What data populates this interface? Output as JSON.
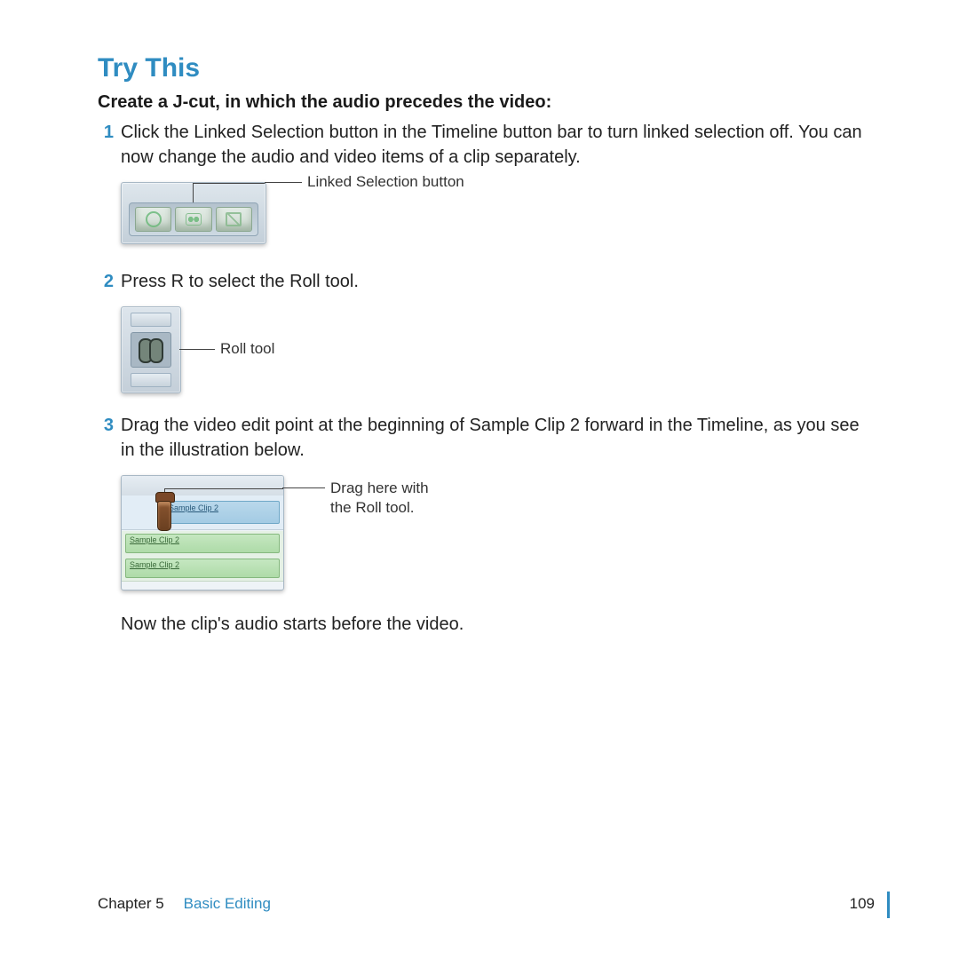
{
  "header": "Try This",
  "subheader": "Create a J-cut, in which the audio precedes the video:",
  "steps": {
    "s1": {
      "num": "1",
      "text": "Click the Linked Selection button in the Timeline button bar to turn linked selection off. You can now change the audio and video items of a clip separately."
    },
    "s2": {
      "num": "2",
      "text": "Press R to select the Roll tool."
    },
    "s3": {
      "num": "3",
      "text": "Drag the video edit point at the beginning of Sample Clip 2 forward in the Timeline, as you see in the illustration below."
    }
  },
  "callouts": {
    "linked_selection": "Linked Selection button",
    "roll_tool": "Roll tool",
    "drag_here_l1": "Drag here with",
    "drag_here_l2": "the Roll tool."
  },
  "fig3": {
    "vclip_label": "Sample Clip 2",
    "aclip1_label": "Sample Clip 2",
    "aclip2_label": "Sample Clip 2"
  },
  "result_text": "Now the clip's audio starts before the video.",
  "footer": {
    "chapter": "Chapter 5",
    "title": "Basic Editing",
    "page": "109"
  }
}
